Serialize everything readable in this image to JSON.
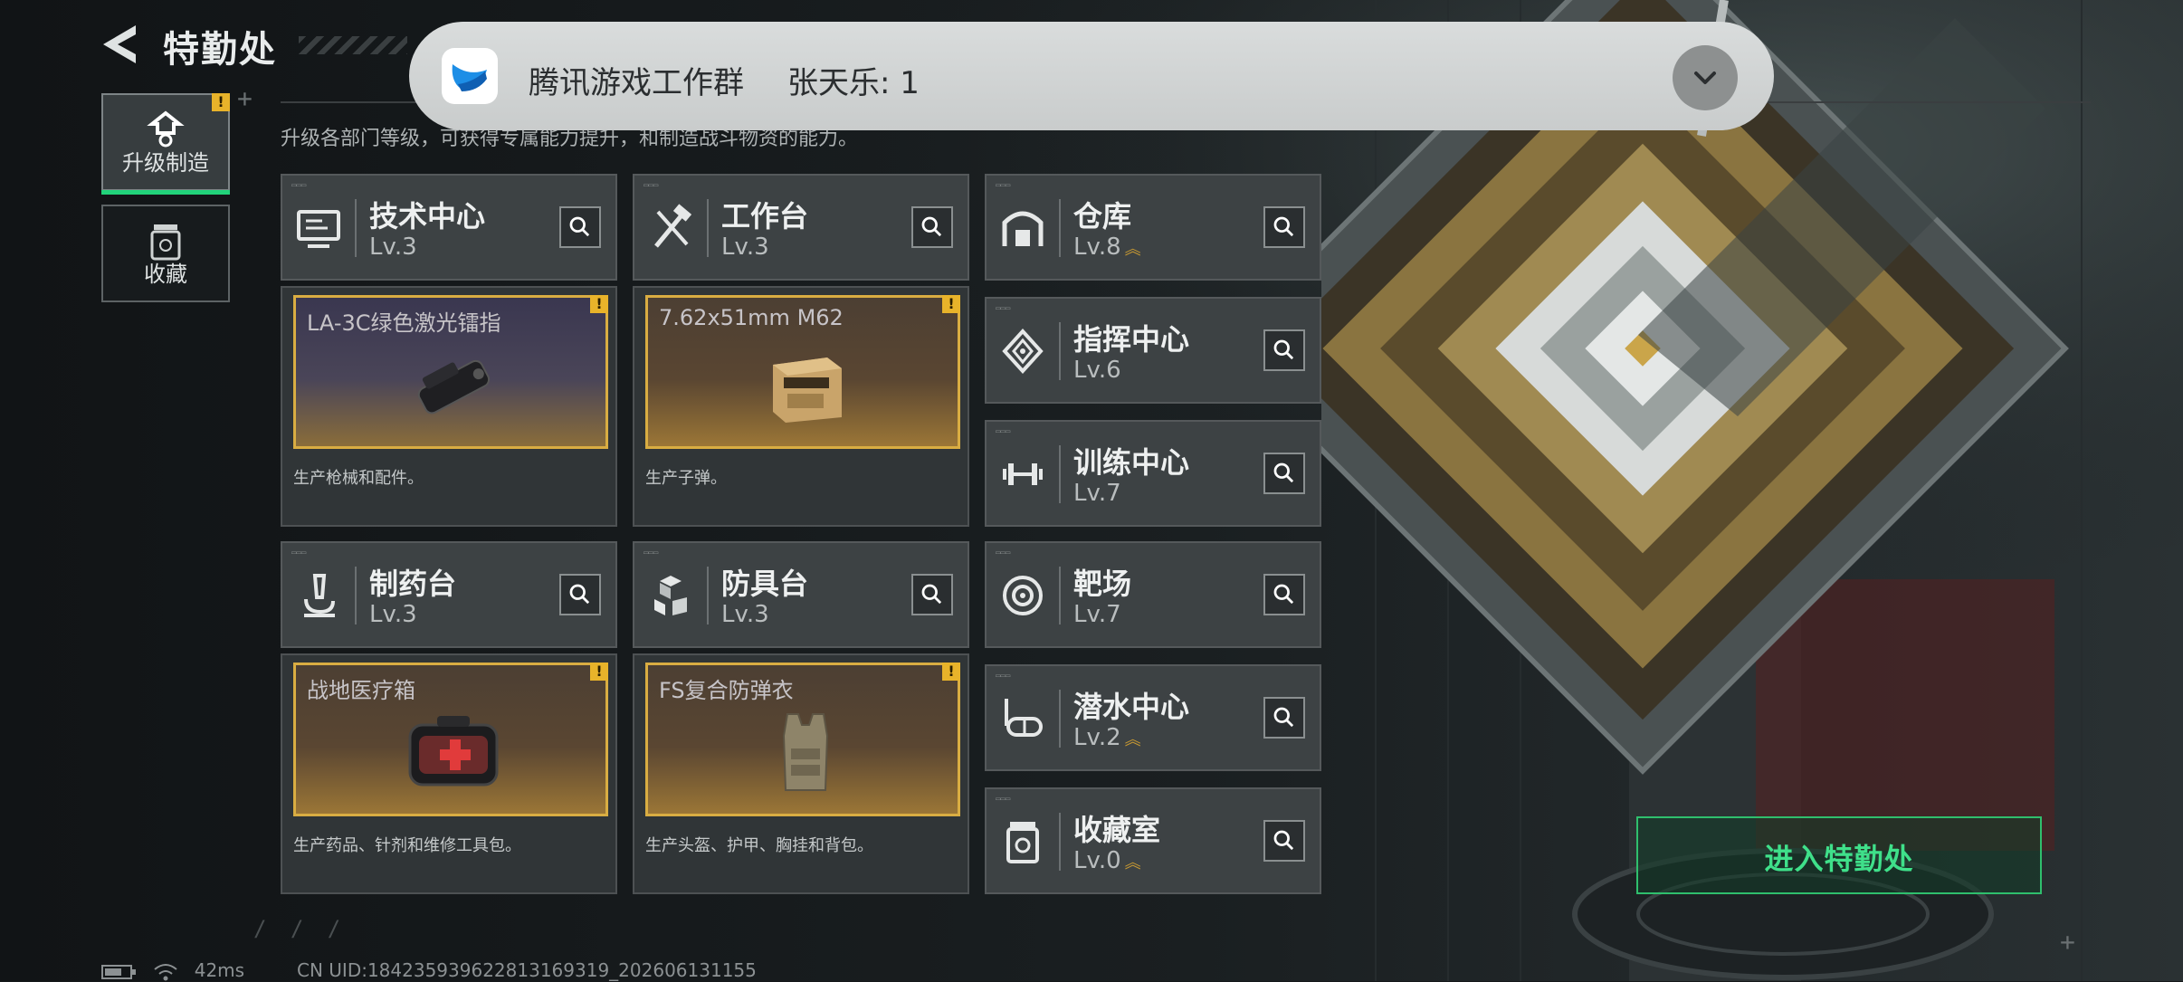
{
  "header": {
    "title": "特勤处",
    "subtitle": "升级各部门等级，可获得专属能力提升，和制造战斗物资的能力。"
  },
  "nav": [
    {
      "label": "升级制造",
      "active": true,
      "badge": "!"
    },
    {
      "label": "收藏",
      "active": false
    }
  ],
  "departments": {
    "tech": {
      "name": "技术中心",
      "level": "Lv.3"
    },
    "workbench": {
      "name": "工作台",
      "level": "Lv.3"
    },
    "warehouse": {
      "name": "仓库",
      "level": "Lv.8"
    },
    "command": {
      "name": "指挥中心",
      "level": "Lv.6"
    },
    "training": {
      "name": "训练中心",
      "level": "Lv.7"
    },
    "pharmacy": {
      "name": "制药台",
      "level": "Lv.3"
    },
    "armor": {
      "name": "防具台",
      "level": "Lv.3"
    },
    "range": {
      "name": "靶场",
      "level": "Lv.7"
    },
    "diving": {
      "name": "潜水中心",
      "level": "Lv.2"
    },
    "collection": {
      "name": "收藏室",
      "level": "Lv.0"
    }
  },
  "production": {
    "tech": {
      "item": "LA-3C绿色激光镭指",
      "desc": "生产枪械和配件。",
      "badge": "!"
    },
    "workbench": {
      "item": "7.62x51mm M62",
      "desc": "生产子弹。",
      "badge": "!"
    },
    "pharmacy": {
      "item": "战地医疗箱",
      "desc": "生产药品、针剂和维修工具包。",
      "badge": "!"
    },
    "armor": {
      "item": "FS复合防弹衣",
      "desc": "生产头盔、护甲、胸挂和背包。",
      "badge": "!"
    }
  },
  "enter_button": "进入特勤处",
  "notification": {
    "app": "腾讯游戏工作群",
    "message": "张天乐: 1"
  },
  "footer": {
    "ping": "42ms",
    "uid": "CN UID:184235939622813169319_202606131155"
  },
  "colors": {
    "accent_green": "#21d37a",
    "badge_yellow": "#e8b32a",
    "tile_border_gold": "#d9ad42"
  },
  "icons": {
    "tech": "monitor-icon",
    "workbench": "hammer-wrench-icon",
    "warehouse": "warehouse-icon",
    "command": "command-chip-icon",
    "training": "dumbbell-icon",
    "pharmacy": "microscope-icon",
    "armor": "cubes-icon",
    "range": "target-icon",
    "diving": "diving-mask-icon",
    "collection": "collection-jar-icon"
  }
}
